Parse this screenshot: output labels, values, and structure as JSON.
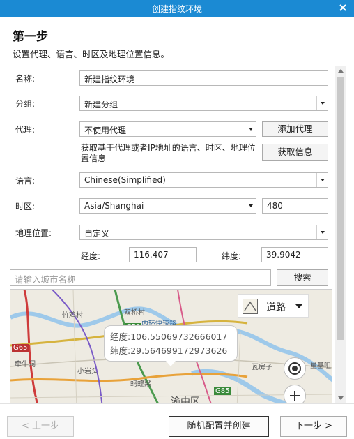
{
  "window": {
    "title": "创建指纹环境"
  },
  "step": {
    "title": "第一步",
    "description": "设置代理、语言、时区及地理位置信息。"
  },
  "form": {
    "name_label": "名称:",
    "name_value": "新建指纹环境",
    "group_label": "分组:",
    "group_value": "新建分组",
    "proxy_label": "代理:",
    "proxy_value": "不使用代理",
    "add_proxy_button": "添加代理",
    "fetch_info_text": "获取基于代理或者IP地址的语言、时区、地理位置信息",
    "fetch_info_button": "获取信息",
    "language_label": "语言:",
    "language_value": "Chinese(Simplified)",
    "timezone_label": "时区:",
    "timezone_value": "Asia/Shanghai",
    "timezone_offset": "480",
    "geo_label": "地理位置:",
    "geo_value": "自定义",
    "longitude_label": "经度:",
    "longitude_value": "116.407",
    "latitude_label": "纬度:",
    "latitude_value": "39.9042",
    "city_placeholder": "请输入城市名称",
    "search_button": "搜索"
  },
  "map": {
    "type_label": "道路",
    "popup_lng": "经度:106.55069732666017",
    "popup_lat": "纬度:29.564699172973626",
    "places": [
      "竹鸡村",
      "双桥村",
      "内环快速路",
      "G50",
      "G65",
      "牵牛洞",
      "小岩头",
      "蚂蝗梁",
      "渝中区",
      "瓦房子",
      "星基咀",
      "G85"
    ]
  },
  "footer": {
    "prev_button": "< 上一步",
    "random_button": "随机配置并创建",
    "next_button": "下一步 >"
  },
  "colors": {
    "titlebar": "#1b8ad3"
  }
}
